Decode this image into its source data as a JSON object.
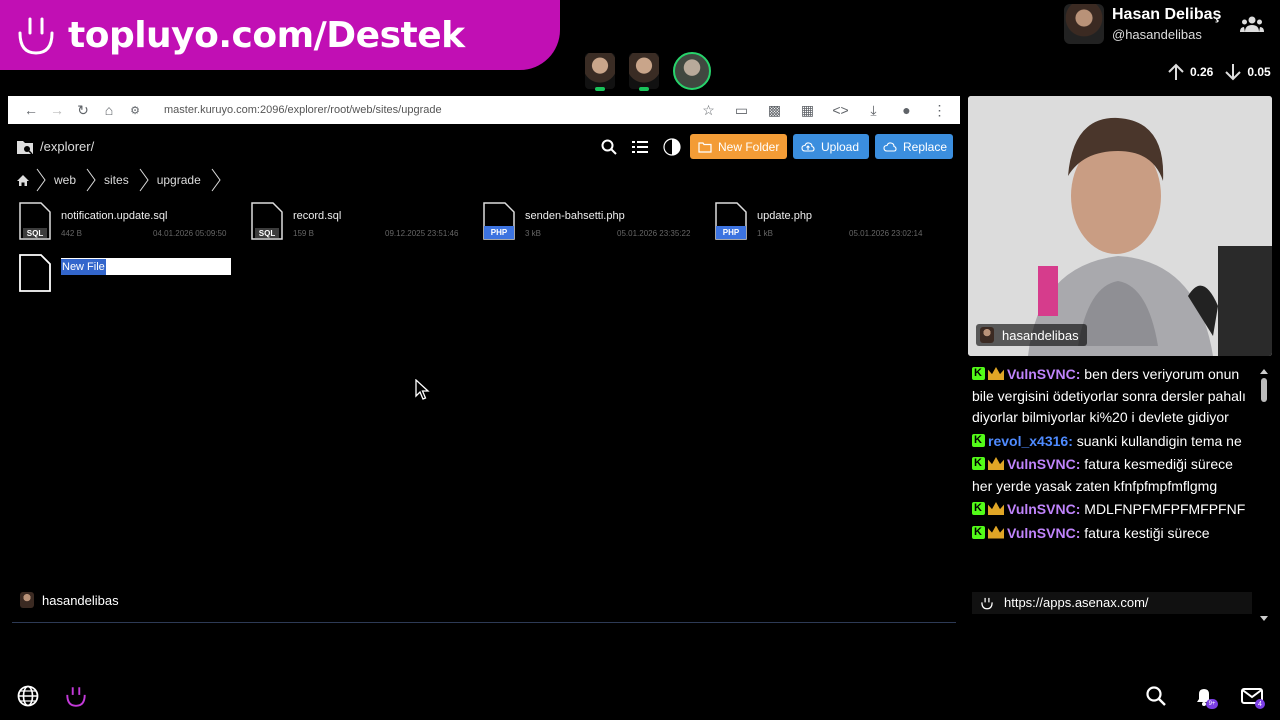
{
  "banner": {
    "text": "topluyo.com/Destek"
  },
  "profile": {
    "name": "Hasan Delibaş",
    "handle": "@hasandelibas"
  },
  "stats": {
    "up": "0.26",
    "down": "0.05"
  },
  "browser": {
    "url": "master.kuruyo.com:2096/explorer/root/web/sites/upgrade"
  },
  "app": {
    "path": "/explorer/",
    "buttons": {
      "new_folder": "New Folder",
      "upload": "Upload",
      "replace": "Replace"
    },
    "breadcrumbs": [
      "web",
      "sites",
      "upgrade"
    ],
    "files": [
      {
        "name": "notification.update.sql",
        "type": "SQL",
        "size": "442 B",
        "date": "04.01.2026 05:09:50"
      },
      {
        "name": "record.sql",
        "type": "SQL",
        "size": "159 B",
        "date": "09.12.2025 23:51:46"
      },
      {
        "name": "senden-bahsetti.php",
        "type": "PHP",
        "size": "3 kB",
        "date": "05.01.2026 23:35:22"
      },
      {
        "name": "update.php",
        "type": "PHP",
        "size": "1 kB",
        "date": "05.01.2026 23:02:14"
      }
    ],
    "new_file_value": "New File"
  },
  "stream_user": "hasandelibas",
  "webcam_label": "hasandelibas",
  "chat": [
    {
      "user": "VulnSVNC",
      "crown": true,
      "color": "#c084fc",
      "text": "ben ders veriyorum onun bile vergisini ödetiyorlar sonra dersler pahalı diyorlar bilmiyorlar ki%20 i devlete gidiyor"
    },
    {
      "user": "revol_x4316",
      "crown": false,
      "color": "#4f8bff",
      "text": "suanki kullandigin tema ne"
    },
    {
      "user": "VulnSVNC",
      "crown": true,
      "color": "#c084fc",
      "text": "fatura kesmediği sürece her yerde yasak zaten kfnfpfmpfmflgmg"
    },
    {
      "user": "VulnSVNC",
      "crown": true,
      "color": "#c084fc",
      "text": "MDLFNPFMFPFMFPFNF"
    },
    {
      "user": "VulnSVNC",
      "crown": true,
      "color": "#c084fc",
      "text": "fatura kestiği sürece"
    }
  ],
  "chat_link": "https://apps.asenax.com/",
  "badges": {
    "notifications": "9+",
    "mail": "4"
  },
  "colors": {
    "banner": "#c10fb4",
    "folder_btn": "#f39c36",
    "upload_btn": "#3b8ede",
    "kick_green": "#53fc18"
  }
}
